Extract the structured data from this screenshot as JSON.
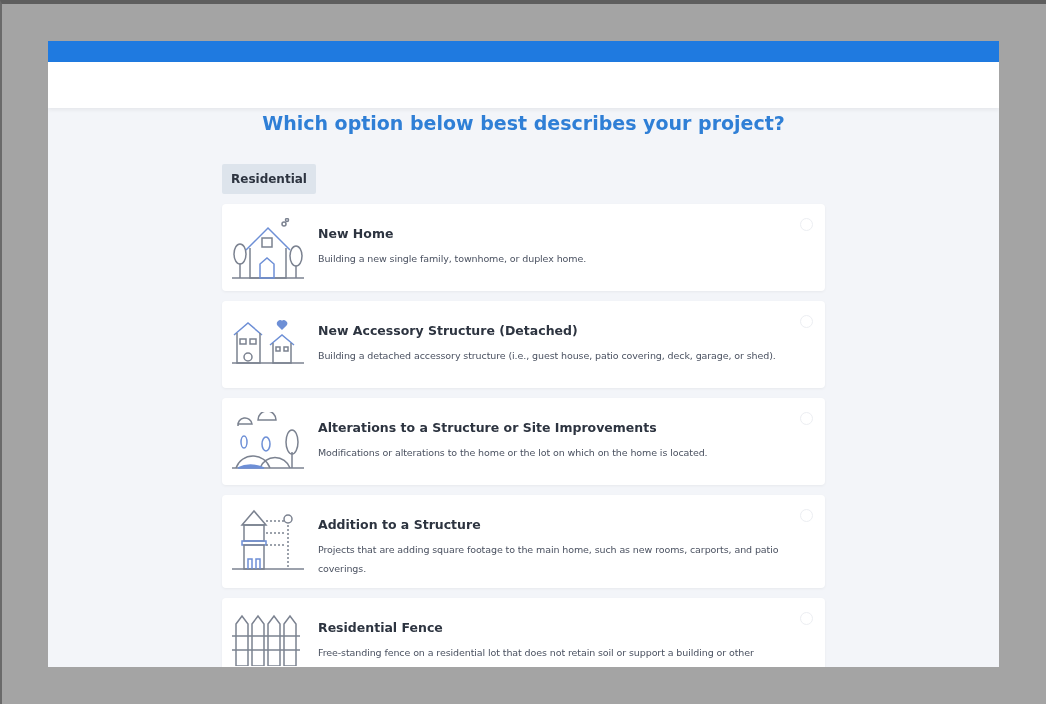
{
  "heading": "Which option below best describes your project?",
  "category": {
    "label": "Residential",
    "selected": true
  },
  "options": [
    {
      "title": "New Home",
      "description": "Building a new single family, townhome, or duplex home.",
      "selected": false
    },
    {
      "title": "New Accessory Structure (Detached)",
      "description": "Building a detached accessory structure (i.e., guest house, patio covering, deck, garage, or shed).",
      "selected": false
    },
    {
      "title": "Alterations to a Structure or Site Improvements",
      "description": "Modifications or alterations to the home or the lot on which on the home is located.",
      "selected": false
    },
    {
      "title": "Addition to a Structure",
      "description": "Projects that are adding square footage to the main home, such as new rooms, carports, and patio coverings.",
      "selected": false
    },
    {
      "title": "Residential Fence",
      "description": "Free-standing fence on a residential lot that does not retain soil or support a building or other",
      "selected": false
    }
  ]
}
